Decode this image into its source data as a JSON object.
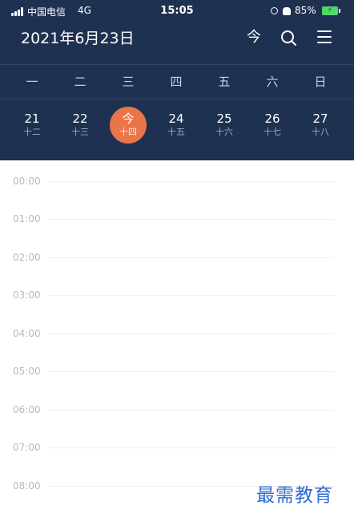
{
  "status_bar": {
    "carrier": "中国电信",
    "network": "4G",
    "time": "15:05",
    "battery": "85%"
  },
  "header": {
    "title": "2021年6月23日",
    "today_label": "今",
    "icons": [
      "search-icon",
      "menu-icon"
    ]
  },
  "weekdays": [
    "一",
    "二",
    "三",
    "四",
    "五",
    "六",
    "日"
  ],
  "days": [
    {
      "num": "21",
      "lunar": "十二"
    },
    {
      "num": "22",
      "lunar": "十三"
    },
    {
      "num": "今",
      "lunar": "十四"
    },
    {
      "num": "24",
      "lunar": "十五"
    },
    {
      "num": "25",
      "lunar": "十六"
    },
    {
      "num": "26",
      "lunar": "十七"
    },
    {
      "num": "27",
      "lunar": "十八"
    }
  ],
  "hours": [
    "00:00",
    "01:00",
    "02:00",
    "03:00",
    "04:00",
    "05:00",
    "06:00",
    "07:00",
    "08:00"
  ],
  "colors": {
    "header_bg": "#1f3150",
    "today_accent": "#e9754b",
    "watermark": "#2d6ad3"
  },
  "watermark": "最需教育"
}
